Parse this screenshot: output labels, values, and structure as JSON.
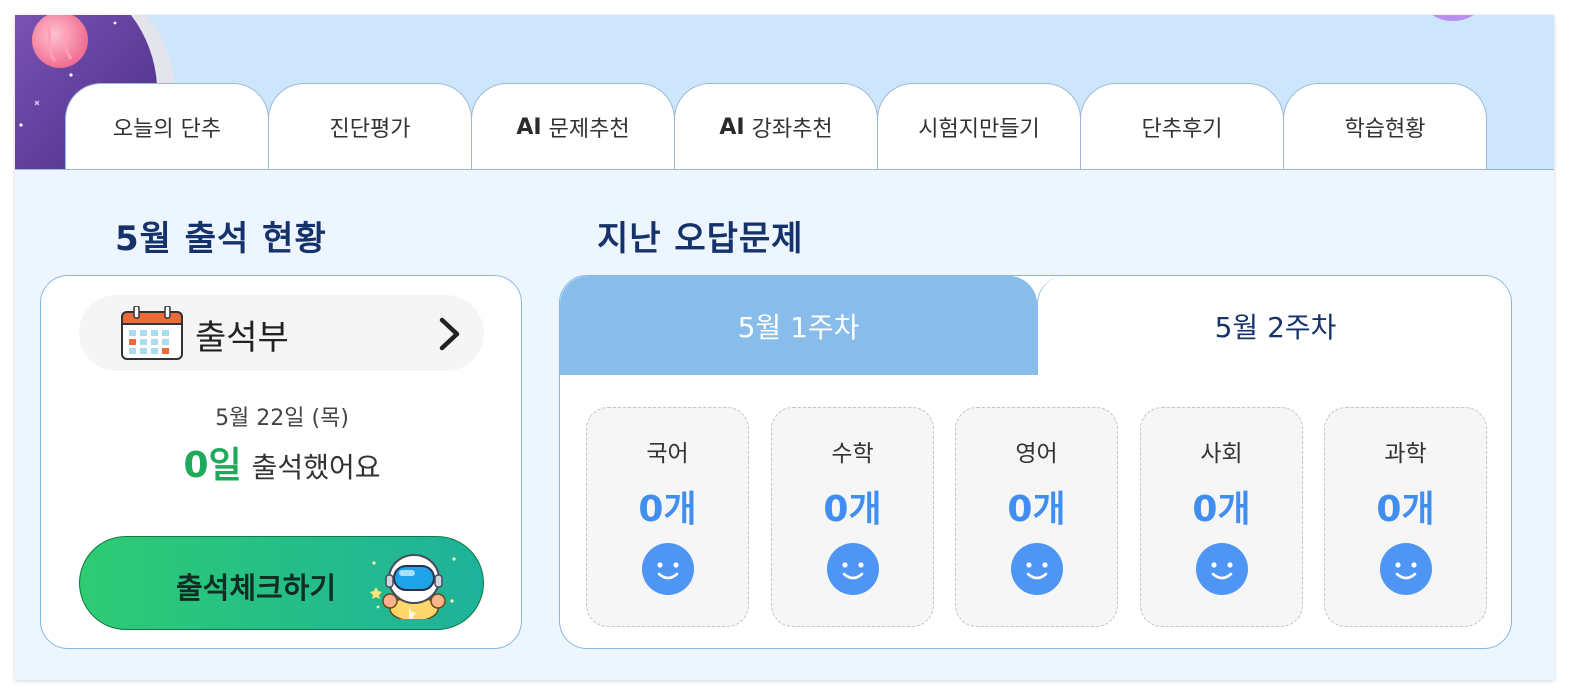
{
  "tabs": [
    {
      "prefix": "",
      "label": "오늘의 단추"
    },
    {
      "prefix": "",
      "label": "진단평가"
    },
    {
      "prefix": "AI",
      "label": "문제추천"
    },
    {
      "prefix": "AI",
      "label": "강좌추천"
    },
    {
      "prefix": "",
      "label": "시험지만들기"
    },
    {
      "prefix": "",
      "label": "단추후기"
    },
    {
      "prefix": "",
      "label": "학습현황"
    }
  ],
  "attendance": {
    "title": "5월 출석 현황",
    "book_label": "출석부",
    "date": "5월 22일 (목)",
    "days_count": "0일",
    "days_suffix": "출석했어요",
    "check_button": "출석체크하기",
    "icons": {
      "calendar": "calendar-icon",
      "chevron": "chevron-right-icon",
      "mascot": "astronaut-icon"
    }
  },
  "wrong_answers": {
    "title": "지난 오답문제",
    "weeks": [
      {
        "label": "5월 1주차",
        "active": true
      },
      {
        "label": "5월 2주차",
        "active": false
      }
    ],
    "subjects": [
      {
        "name": "국어",
        "count": "0개"
      },
      {
        "name": "수학",
        "count": "0개"
      },
      {
        "name": "영어",
        "count": "0개"
      },
      {
        "name": "사회",
        "count": "0개"
      },
      {
        "name": "과학",
        "count": "0개"
      }
    ]
  },
  "colors": {
    "header_bg": "#cde6fb",
    "page_bg": "#edf5ff",
    "title": "#16326b",
    "active_week_tab": "#88bcea",
    "attendance_green": "#1fa95a",
    "count_blue": "#3f8ef0",
    "button_gradient_start": "#2ecb73",
    "button_gradient_end": "#1eb29b"
  }
}
